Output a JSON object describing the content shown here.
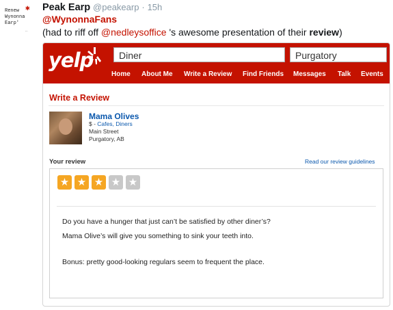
{
  "avatar": {
    "lines": [
      "Renew",
      "Wynonna",
      "Earp'"
    ]
  },
  "tweet": {
    "name": "Peak Earp",
    "handle": "@peakearp",
    "separator": "·",
    "time": "15h",
    "reply_to": "@WynonnaFans",
    "text_prefix": "(had to riff off ",
    "mention": "@nedleysoffice",
    "text_middle": " 's awesome presentation of their ",
    "text_bold": "review",
    "text_suffix": ")"
  },
  "yelp": {
    "logo": "yelp",
    "search_term": "Diner",
    "location": "Purgatory",
    "nav": [
      "Home",
      "About Me",
      "Write a Review",
      "Find Friends",
      "Messages",
      "Talk",
      "Events"
    ],
    "brand_color": "#c41200"
  },
  "page": {
    "title": "Write a Review",
    "business": {
      "name": "Mama Olives",
      "price": "$",
      "category_sep": " - ",
      "categories": "Cafes, Diners",
      "address1": "Main Street",
      "address2": "Purgatory, AB"
    },
    "your_review_label": "Your review",
    "guidelines_link": "Read our review guidelines"
  },
  "review": {
    "rating": 3,
    "max_rating": 5,
    "line1": "Do you have a hunger that just can’t be satisfied by other diner’s?",
    "line2": "Mama Olive’s will give you something to sink your teeth into.",
    "line3": "Bonus: pretty good-looking regulars seem to frequent the place."
  }
}
